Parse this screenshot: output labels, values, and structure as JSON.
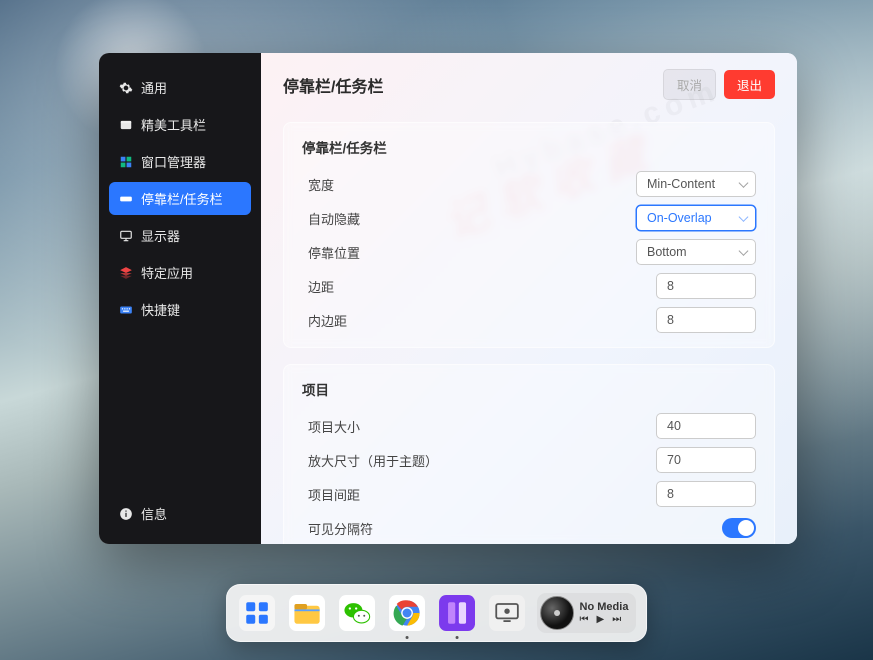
{
  "sidebar": {
    "items": [
      {
        "label": "通用",
        "icon": "gear"
      },
      {
        "label": "精美工具栏",
        "icon": "window"
      },
      {
        "label": "窗口管理器",
        "icon": "grid"
      },
      {
        "label": "停靠栏/任务栏",
        "icon": "dock",
        "active": true
      },
      {
        "label": "显示器",
        "icon": "monitor"
      },
      {
        "label": "特定应用",
        "icon": "stack"
      },
      {
        "label": "快捷键",
        "icon": "keyboard"
      }
    ],
    "footer": {
      "label": "信息",
      "icon": "info"
    }
  },
  "header": {
    "title": "停靠栏/任务栏",
    "cancel": "取消",
    "exit": "退出"
  },
  "sections": [
    {
      "title": "停靠栏/任务栏",
      "rows": [
        {
          "label": "宽度",
          "type": "select",
          "value": "Min-Content"
        },
        {
          "label": "自动隐藏",
          "type": "select",
          "value": "On-Overlap",
          "focused": true
        },
        {
          "label": "停靠位置",
          "type": "select",
          "value": "Bottom"
        },
        {
          "label": "边距",
          "type": "number",
          "value": "8"
        },
        {
          "label": "内边距",
          "type": "number",
          "value": "8"
        }
      ]
    },
    {
      "title": "项目",
      "rows": [
        {
          "label": "项目大小",
          "type": "number",
          "value": "40"
        },
        {
          "label": "放大尺寸（用于主题）",
          "type": "number",
          "value": "70"
        },
        {
          "label": "项目间距",
          "type": "number",
          "value": "8"
        },
        {
          "label": "可见分隔符",
          "type": "toggle",
          "value": true
        }
      ]
    }
  ],
  "dock": {
    "apps": [
      "start-menu",
      "files",
      "wechat",
      "chrome",
      "settings-app",
      "monitor-ctl"
    ],
    "media": {
      "title": "No Media"
    }
  },
  "watermark": {
    "a": "记软收藏",
    "b": "Hybase.com"
  }
}
